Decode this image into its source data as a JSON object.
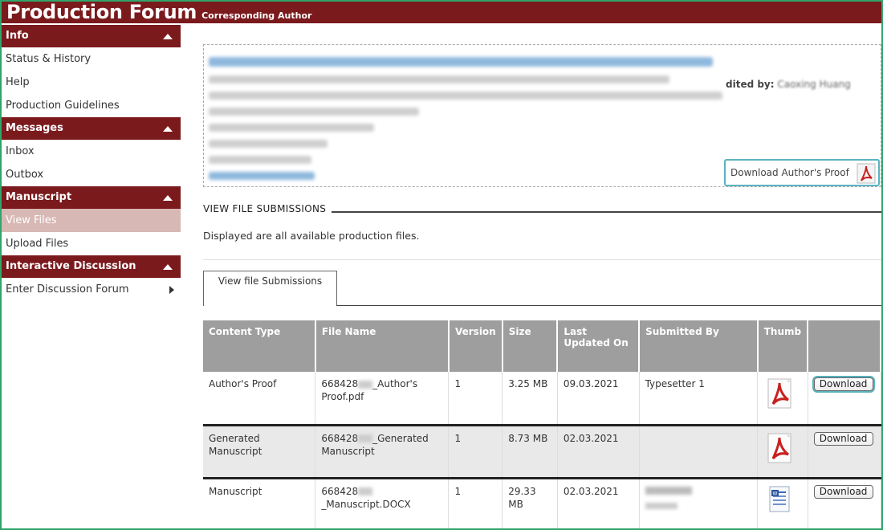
{
  "header": {
    "title": "Production Forum",
    "subtitle": "Corresponding Author"
  },
  "sidebar": {
    "sections": [
      {
        "label": "Info",
        "items": [
          "Status & History",
          "Help",
          "Production Guidelines"
        ]
      },
      {
        "label": "Messages",
        "items": [
          "Inbox",
          "Outbox"
        ]
      },
      {
        "label": "Manuscript",
        "items": [
          "View Files",
          "Upload Files"
        ],
        "active": "View Files"
      },
      {
        "label": "Interactive Discussion",
        "items": [
          "Enter Discussion Forum"
        ]
      }
    ]
  },
  "info": {
    "edited_by_label": "dited by:",
    "edited_by_value": "Caoxing Huang",
    "download_proof_label": "Download Author's Proof"
  },
  "files_section": {
    "title": "VIEW FILE SUBMISSIONS",
    "description": "Displayed are all available production files.",
    "tab_label": "View file Submissions"
  },
  "table": {
    "headers": [
      "Content Type",
      "File Name",
      "Version",
      "Size",
      "Last Updated On",
      "Submitted By",
      "Thumb",
      ""
    ],
    "rows": [
      {
        "content_type": "Author's Proof",
        "file_name_prefix": "668428",
        "file_name_rest": "_Author's Proof.pdf",
        "version": "1",
        "size": "3.25 MB",
        "last_updated": "09.03.2021",
        "submitted_by": "Typesetter 1",
        "thumb": "pdf-icon",
        "action": "Download"
      },
      {
        "content_type": "Generated Manuscript",
        "file_name_prefix": "668428",
        "file_name_rest": "_Generated Manuscript",
        "version": "1",
        "size": "8.73 MB",
        "last_updated": "02.03.2021",
        "submitted_by": "",
        "thumb": "pdf-icon",
        "action": "Download"
      },
      {
        "content_type": "Manuscript",
        "file_name_prefix": "668428",
        "file_name_rest": "_Manuscript.DOCX",
        "version": "1",
        "size": "29.33 MB",
        "last_updated": "02.03.2021",
        "submitted_by": "",
        "thumb": "word-doc-icon",
        "action": "Download"
      }
    ]
  },
  "colors": {
    "brand": "#7b1a1d",
    "active_nav": "#d8b8b4",
    "table_header": "#9e9e9e",
    "focus_ring": "#5ab3bf"
  }
}
